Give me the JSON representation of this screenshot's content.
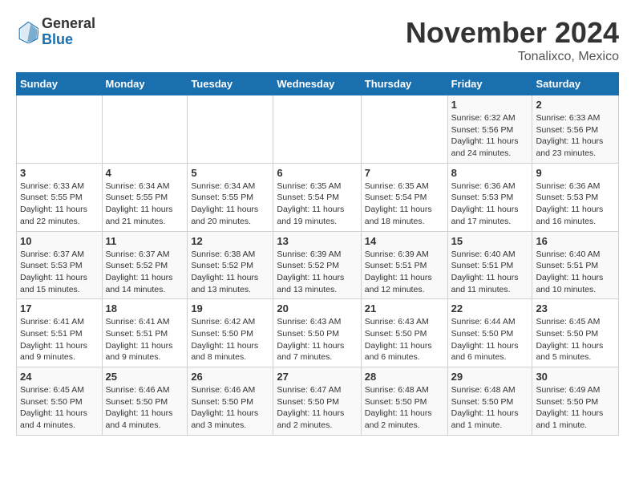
{
  "header": {
    "logo_general": "General",
    "logo_blue": "Blue",
    "month_title": "November 2024",
    "location": "Tonalixco, Mexico"
  },
  "days_of_week": [
    "Sunday",
    "Monday",
    "Tuesday",
    "Wednesday",
    "Thursday",
    "Friday",
    "Saturday"
  ],
  "weeks": [
    [
      {
        "day": "",
        "info": ""
      },
      {
        "day": "",
        "info": ""
      },
      {
        "day": "",
        "info": ""
      },
      {
        "day": "",
        "info": ""
      },
      {
        "day": "",
        "info": ""
      },
      {
        "day": "1",
        "info": "Sunrise: 6:32 AM\nSunset: 5:56 PM\nDaylight: 11 hours and 24 minutes."
      },
      {
        "day": "2",
        "info": "Sunrise: 6:33 AM\nSunset: 5:56 PM\nDaylight: 11 hours and 23 minutes."
      }
    ],
    [
      {
        "day": "3",
        "info": "Sunrise: 6:33 AM\nSunset: 5:55 PM\nDaylight: 11 hours and 22 minutes."
      },
      {
        "day": "4",
        "info": "Sunrise: 6:34 AM\nSunset: 5:55 PM\nDaylight: 11 hours and 21 minutes."
      },
      {
        "day": "5",
        "info": "Sunrise: 6:34 AM\nSunset: 5:55 PM\nDaylight: 11 hours and 20 minutes."
      },
      {
        "day": "6",
        "info": "Sunrise: 6:35 AM\nSunset: 5:54 PM\nDaylight: 11 hours and 19 minutes."
      },
      {
        "day": "7",
        "info": "Sunrise: 6:35 AM\nSunset: 5:54 PM\nDaylight: 11 hours and 18 minutes."
      },
      {
        "day": "8",
        "info": "Sunrise: 6:36 AM\nSunset: 5:53 PM\nDaylight: 11 hours and 17 minutes."
      },
      {
        "day": "9",
        "info": "Sunrise: 6:36 AM\nSunset: 5:53 PM\nDaylight: 11 hours and 16 minutes."
      }
    ],
    [
      {
        "day": "10",
        "info": "Sunrise: 6:37 AM\nSunset: 5:53 PM\nDaylight: 11 hours and 15 minutes."
      },
      {
        "day": "11",
        "info": "Sunrise: 6:37 AM\nSunset: 5:52 PM\nDaylight: 11 hours and 14 minutes."
      },
      {
        "day": "12",
        "info": "Sunrise: 6:38 AM\nSunset: 5:52 PM\nDaylight: 11 hours and 13 minutes."
      },
      {
        "day": "13",
        "info": "Sunrise: 6:39 AM\nSunset: 5:52 PM\nDaylight: 11 hours and 13 minutes."
      },
      {
        "day": "14",
        "info": "Sunrise: 6:39 AM\nSunset: 5:51 PM\nDaylight: 11 hours and 12 minutes."
      },
      {
        "day": "15",
        "info": "Sunrise: 6:40 AM\nSunset: 5:51 PM\nDaylight: 11 hours and 11 minutes."
      },
      {
        "day": "16",
        "info": "Sunrise: 6:40 AM\nSunset: 5:51 PM\nDaylight: 11 hours and 10 minutes."
      }
    ],
    [
      {
        "day": "17",
        "info": "Sunrise: 6:41 AM\nSunset: 5:51 PM\nDaylight: 11 hours and 9 minutes."
      },
      {
        "day": "18",
        "info": "Sunrise: 6:41 AM\nSunset: 5:51 PM\nDaylight: 11 hours and 9 minutes."
      },
      {
        "day": "19",
        "info": "Sunrise: 6:42 AM\nSunset: 5:50 PM\nDaylight: 11 hours and 8 minutes."
      },
      {
        "day": "20",
        "info": "Sunrise: 6:43 AM\nSunset: 5:50 PM\nDaylight: 11 hours and 7 minutes."
      },
      {
        "day": "21",
        "info": "Sunrise: 6:43 AM\nSunset: 5:50 PM\nDaylight: 11 hours and 6 minutes."
      },
      {
        "day": "22",
        "info": "Sunrise: 6:44 AM\nSunset: 5:50 PM\nDaylight: 11 hours and 6 minutes."
      },
      {
        "day": "23",
        "info": "Sunrise: 6:45 AM\nSunset: 5:50 PM\nDaylight: 11 hours and 5 minutes."
      }
    ],
    [
      {
        "day": "24",
        "info": "Sunrise: 6:45 AM\nSunset: 5:50 PM\nDaylight: 11 hours and 4 minutes."
      },
      {
        "day": "25",
        "info": "Sunrise: 6:46 AM\nSunset: 5:50 PM\nDaylight: 11 hours and 4 minutes."
      },
      {
        "day": "26",
        "info": "Sunrise: 6:46 AM\nSunset: 5:50 PM\nDaylight: 11 hours and 3 minutes."
      },
      {
        "day": "27",
        "info": "Sunrise: 6:47 AM\nSunset: 5:50 PM\nDaylight: 11 hours and 2 minutes."
      },
      {
        "day": "28",
        "info": "Sunrise: 6:48 AM\nSunset: 5:50 PM\nDaylight: 11 hours and 2 minutes."
      },
      {
        "day": "29",
        "info": "Sunrise: 6:48 AM\nSunset: 5:50 PM\nDaylight: 11 hours and 1 minute."
      },
      {
        "day": "30",
        "info": "Sunrise: 6:49 AM\nSunset: 5:50 PM\nDaylight: 11 hours and 1 minute."
      }
    ]
  ]
}
